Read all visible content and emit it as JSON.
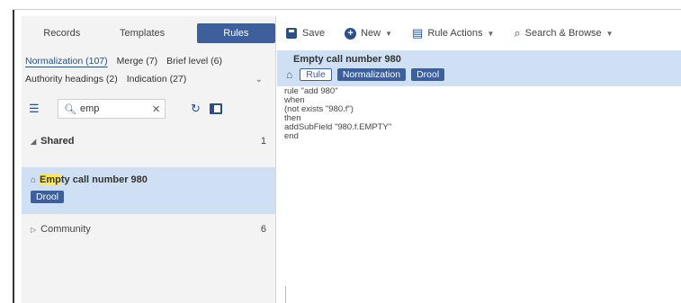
{
  "tabs": [
    {
      "label": "Records",
      "active": false
    },
    {
      "label": "Templates",
      "active": false
    },
    {
      "label": "Rules",
      "active": true
    }
  ],
  "filters": {
    "row1": [
      "Normalization (107)",
      "Merge (7)",
      "Brief level (6)"
    ],
    "row2": [
      "Authority headings (2)",
      "Indication (27)"
    ]
  },
  "search": {
    "value": "emp"
  },
  "tree": {
    "shared": {
      "label": "Shared",
      "count": "1"
    },
    "selected_rule": {
      "title_highlight": "Emp",
      "title_rest": "ty call number 980",
      "badge": "Drool"
    },
    "community": {
      "label": "Community",
      "count": "6"
    }
  },
  "toolbar": {
    "save": "Save",
    "new": "New",
    "rule_actions": "Rule Actions",
    "search_browse": "Search & Browse"
  },
  "editor": {
    "title": "Empty call number 980",
    "tags": [
      "Rule",
      "Normalization",
      "Drool"
    ],
    "code_lines": [
      "rule \"add 980\"",
      "when",
      "(not exists \"980.f\")",
      "then",
      "addSubField \"980.f.EMPTY\"",
      "end"
    ]
  },
  "colors": {
    "accent": "#3d5f9c",
    "selection": "#cfe0f4",
    "highlight": "#ffe94d"
  },
  "icons": [
    "list-filter-icon",
    "search-icon",
    "close-icon",
    "refresh-icon",
    "view-icon",
    "home-icon",
    "save-icon",
    "plus-circle-icon",
    "rule-actions-icon",
    "chevron-down-icon"
  ]
}
